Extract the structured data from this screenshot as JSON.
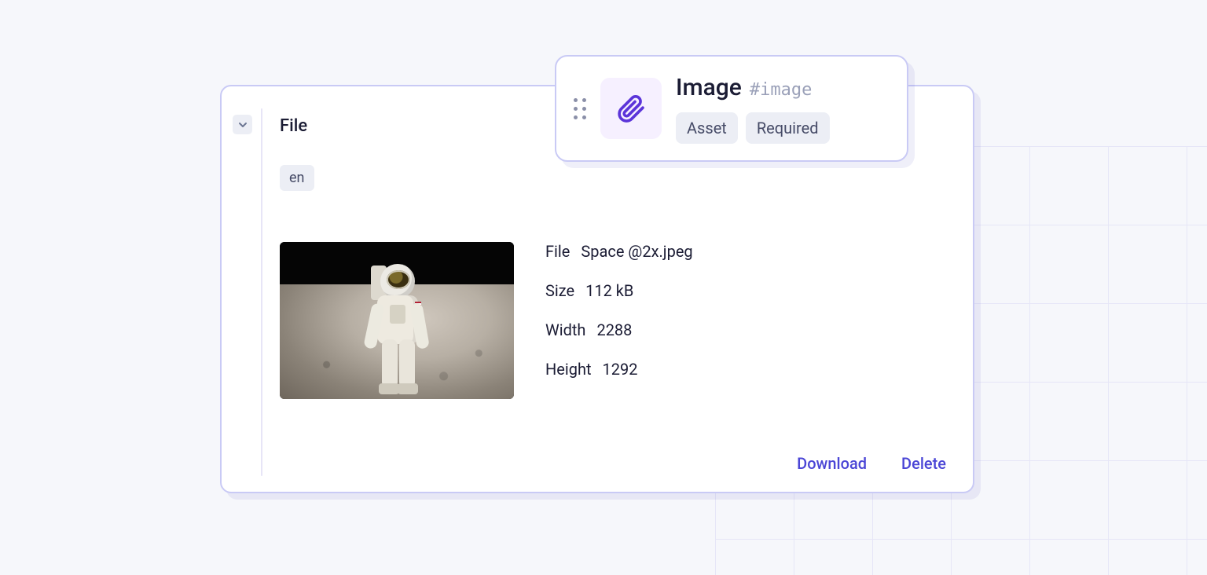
{
  "panel": {
    "section_title": "File",
    "language_chip": "en",
    "meta": {
      "file_label": "File",
      "file_value": "Space @2x.jpeg",
      "size_label": "Size",
      "size_value": "112 kB",
      "width_label": "Width",
      "width_value": "2288",
      "height_label": "Height",
      "height_value": "1292"
    },
    "actions": {
      "download": "Download",
      "delete": "Delete"
    }
  },
  "badge": {
    "title": "Image",
    "slug": "#image",
    "chips": {
      "type": "Asset",
      "required": "Required"
    },
    "icon": "attachment-icon"
  }
}
